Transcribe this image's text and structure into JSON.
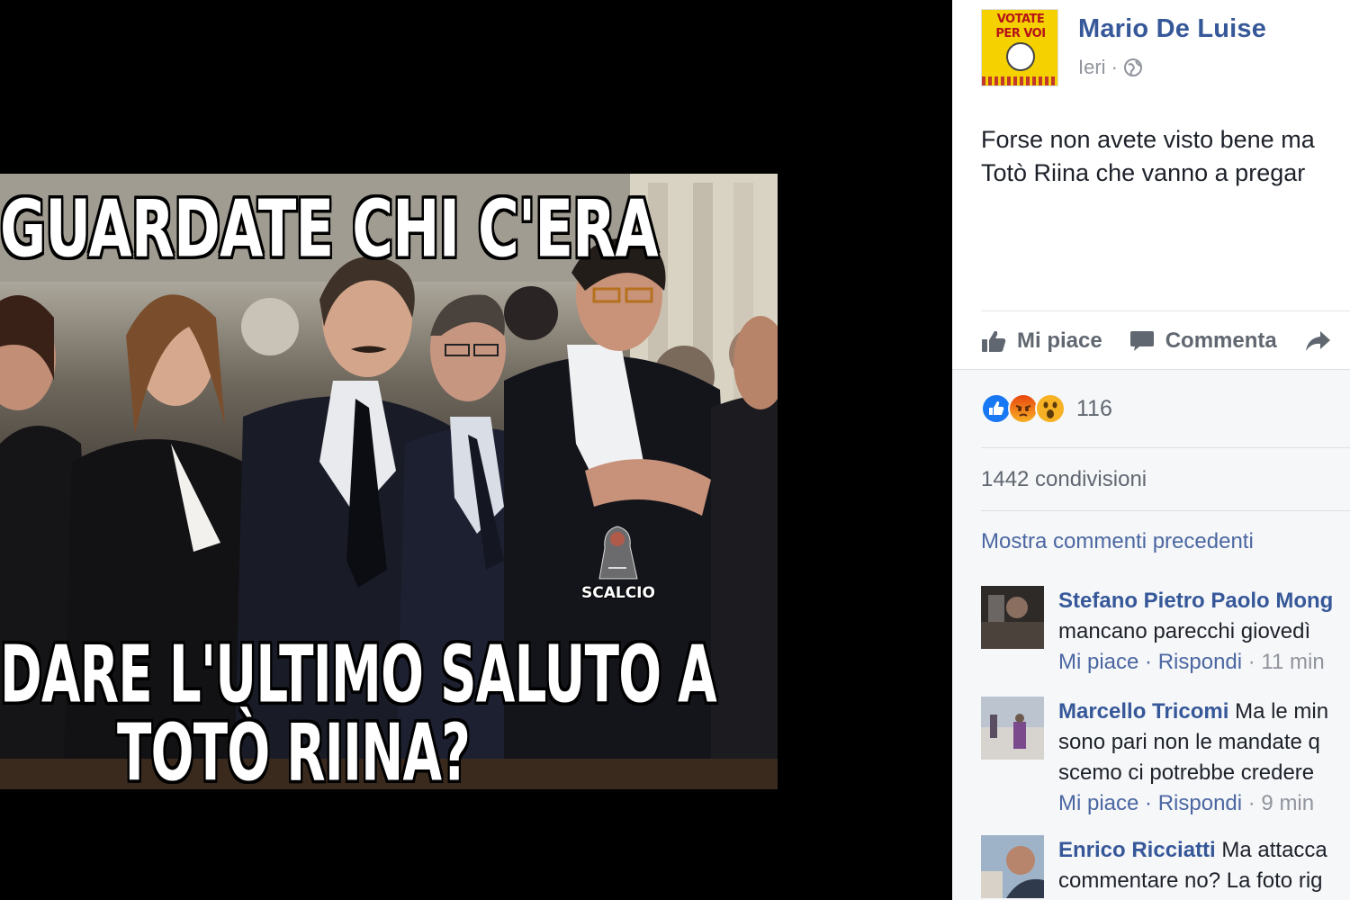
{
  "photo": {
    "meme_top": "Guardate chi c'era",
    "meme_bottom_1": "dare l'ultimo saluto a",
    "meme_bottom_2": "Totò Riina?",
    "watermark": "SCALCIO"
  },
  "post": {
    "avatar_line1": "VOTATE",
    "avatar_line2": "PER VOI",
    "author": "Mario De Luise",
    "time": "Ieri",
    "dot": "·",
    "globe_icon": "globe-icon",
    "text_line1": "Forse non avete visto bene ma",
    "text_line2": "Totò Riina che vanno a pregar"
  },
  "actions": {
    "like": "Mi piace",
    "comment": "Commenta",
    "share_icon": "share-arrow-icon"
  },
  "reactions": {
    "icons": [
      "like-reaction-icon",
      "angry-reaction-icon",
      "wow-reaction-icon"
    ],
    "count": "116",
    "colors": {
      "like": "#1877f2",
      "angry": "#e9710f",
      "wow": "#f7b125"
    }
  },
  "shares": "1442 condivisioni",
  "show_previous": "Mostra commenti precedenti",
  "comments": [
    {
      "author": "Stefano Pietro Paolo Mong",
      "text_inline": "",
      "line2": "mancano parecchi giovedì",
      "line3": "",
      "like": "Mi piace",
      "sep": " · ",
      "reply": "Rispondi",
      "time": " · 11 min"
    },
    {
      "author": "Marcello Tricomi",
      "text_inline": " Ma le min",
      "line2": "sono pari non le mandate q",
      "line3": "scemo ci potrebbe credere",
      "like": "Mi piace",
      "sep": " · ",
      "reply": "Rispondi",
      "time": " · 9 min"
    },
    {
      "author": "Enrico Ricciatti",
      "text_inline": " Ma attacca",
      "line2": "commentare no? La foto rig",
      "line3": "",
      "like": "",
      "sep": "",
      "reply": "",
      "time": ""
    }
  ]
}
